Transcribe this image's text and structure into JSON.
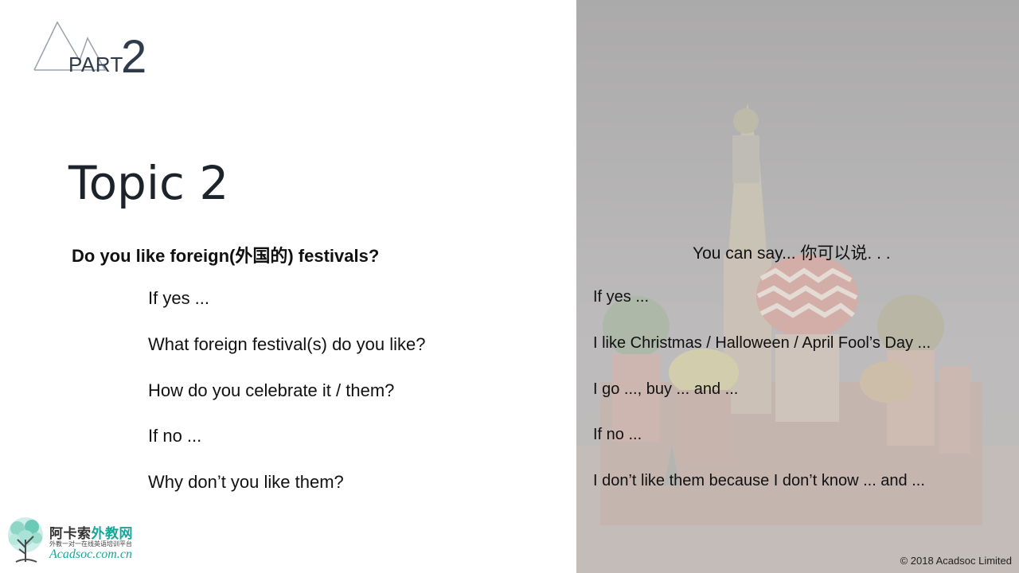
{
  "header": {
    "part_label": "PART",
    "part_number": "2"
  },
  "topic": {
    "title": "Topic 2"
  },
  "question": {
    "main": "Do you like foreign(外国的) festivals?",
    "lines": [
      "If yes ...",
      "What foreign festival(s) do you like?",
      "How do you celebrate it / them?",
      "If no ...",
      "Why don’t you like them?"
    ]
  },
  "answers": {
    "title": "You can say... 你可以说. . .",
    "lines": [
      "If yes ...",
      "I like Christmas / Halloween / April Fool’s Day ...",
      "I go ..., buy ... and ...",
      "If no ...",
      "I don’t like them because I don’t know ... and ..."
    ]
  },
  "brand": {
    "name_primary": "阿卡索",
    "name_accent": "外教网",
    "tagline": "外教一对一在线英语培训平台",
    "url": "Acadsoc.com.cn"
  },
  "footer": {
    "copyright": "© 2018 Acadsoc Limited"
  },
  "colors": {
    "accent": "#1aa59a",
    "heading": "#2f3b4a"
  },
  "icons": {
    "part_logo": "mountain-icon",
    "brand_logo": "tree-icon"
  }
}
